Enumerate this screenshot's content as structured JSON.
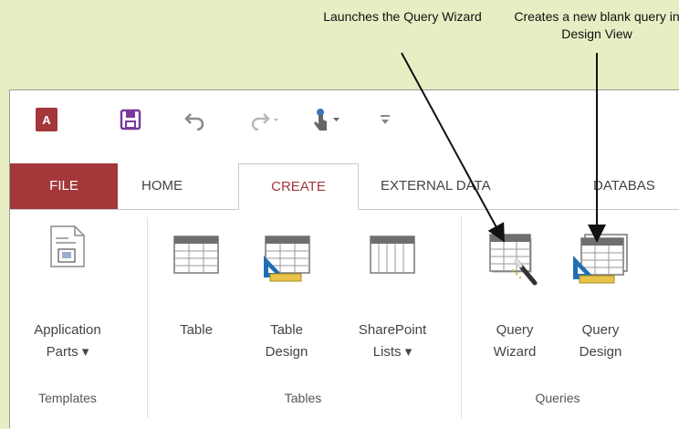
{
  "callouts": {
    "query_wizard": "Launches the Query Wizard",
    "query_design": "Creates a new blank query in Design View"
  },
  "quick_access": {
    "app_icon": "access-logo-icon",
    "logo_text": "A",
    "save": "save-icon",
    "undo": "undo-icon",
    "redo": "redo-icon",
    "touch": "touch-mode-icon",
    "customize": "customize-qat-icon"
  },
  "tabs": [
    {
      "label": "FILE"
    },
    {
      "label": "HOME"
    },
    {
      "label": "CREATE"
    },
    {
      "label": "EXTERNAL DATA"
    },
    {
      "label": "DATABAS"
    }
  ],
  "ribbon": {
    "templates": {
      "group_label": "Templates",
      "application_parts": {
        "line1": "Application",
        "line2": "Parts ▾"
      }
    },
    "tables": {
      "group_label": "Tables",
      "table": {
        "line1": "Table"
      },
      "table_design": {
        "line1": "Table",
        "line2": "Design"
      },
      "sharepoint_lists": {
        "line1": "SharePoint",
        "line2": "Lists ▾"
      }
    },
    "queries": {
      "group_label": "Queries",
      "query_wizard": {
        "line1": "Query",
        "line2": "Wizard"
      },
      "query_design": {
        "line1": "Query",
        "line2": "Design"
      }
    }
  },
  "colors": {
    "background": "#e8edc4",
    "access_red": "#a4373a",
    "table_gray": "#6e6e6e",
    "design_blue": "#1f6fb2",
    "ruler_yellow": "#e8c24a"
  }
}
